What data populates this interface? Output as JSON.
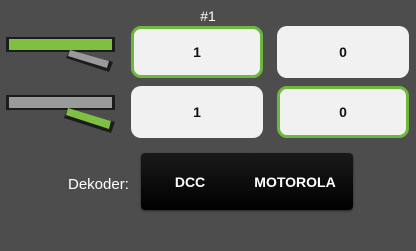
{
  "page": {
    "title": "#1"
  },
  "colors": {
    "accent_green": "#6fb83f",
    "background": "#4d4d4d",
    "button_bg": "#f1f1f1",
    "toggle_bg": "#000000"
  },
  "rows": [
    {
      "icon": "turnout-diverging-icon",
      "buttons": [
        {
          "label": "1",
          "active": true
        },
        {
          "label": "0",
          "active": false
        }
      ]
    },
    {
      "icon": "turnout-diverging-icon",
      "buttons": [
        {
          "label": "1",
          "active": false
        },
        {
          "label": "0",
          "active": true
        }
      ]
    }
  ],
  "decoder": {
    "label": "Dekoder:",
    "options": [
      "DCC",
      "MOTOROLA"
    ]
  }
}
